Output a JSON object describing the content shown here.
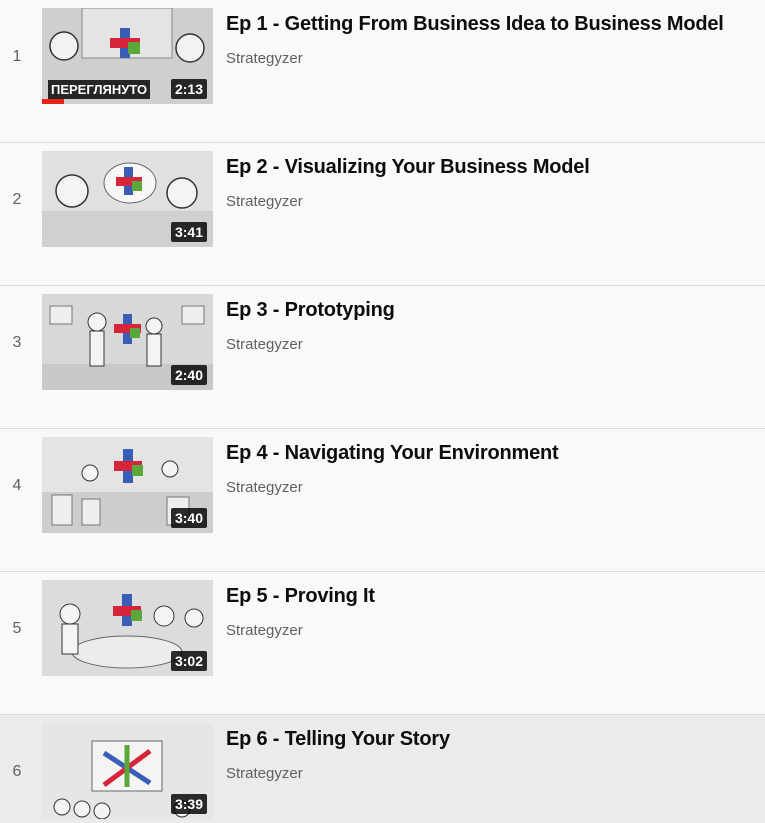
{
  "playlist": {
    "items": [
      {
        "index": "1",
        "title": "Ep 1 - Getting From Business Idea to Business Model",
        "channel": "Strategyzer",
        "duration": "2:13",
        "badge": "ПЕРЕГЛЯНУТО",
        "progress": 0.13
      },
      {
        "index": "2",
        "title": "Ep 2 - Visualizing Your Business Model",
        "channel": "Strategyzer",
        "duration": "3:41"
      },
      {
        "index": "3",
        "title": "Ep 3 - Prototyping",
        "channel": "Strategyzer",
        "duration": "2:40"
      },
      {
        "index": "4",
        "title": "Ep 4 - Navigating Your Environment",
        "channel": "Strategyzer",
        "duration": "3:40"
      },
      {
        "index": "5",
        "title": "Ep 5 - Proving It",
        "channel": "Strategyzer",
        "duration": "3:02"
      },
      {
        "index": "6",
        "title": "Ep 6 - Telling Your Story",
        "channel": "Strategyzer",
        "duration": "3:39"
      }
    ]
  }
}
